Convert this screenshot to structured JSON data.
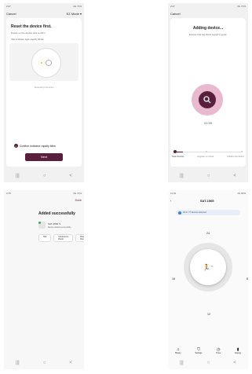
{
  "colors": {
    "accent": "#5a1f3d",
    "pink": "#e9b9cf",
    "gray": "#eaeaea"
  },
  "s1": {
    "status_time": "2:27",
    "status_right": "4G 71%",
    "cancel": "Cancel",
    "mode": "EZ Mode",
    "title": "Reset the device first.",
    "line1": "Power on the device and confirm",
    "line2": "that indicator light rapidly blinks",
    "resetting": "Resetting Devices",
    "confirm": "Confirm indicator rapidly blink",
    "next": "Next"
  },
  "s2": {
    "status_time": "2:27",
    "status_right": "4G 71%",
    "cancel": "Cancel",
    "title": "Adding device...",
    "subtitle": "Ensure that the Wi-Fi signal is good.",
    "timer": "01:59",
    "progress_pct": 12,
    "steps": [
      {
        "label": "Scan devices"
      },
      {
        "label": "Register on Cloud"
      },
      {
        "label": "Initialize the device"
      }
    ]
  },
  "s3": {
    "status_time": "2:15",
    "status_right": "4G 71%",
    "done": "Done",
    "title": "Added successfully",
    "device_name": "SAT-1565",
    "device_sub": "Device added successfully",
    "room_buttons": [
      "Hall",
      "Conference Room",
      "Break Room"
    ]
  },
  "s4": {
    "status_time": "11:01",
    "status_right": "4G 69%",
    "title": "SAT-1565",
    "banner": "Wi-Fi: 77 Devices detected",
    "dial_top": "24",
    "dial_left": "16",
    "dial_right": "8",
    "dial_bottom": "12",
    "tabs": [
      "History",
      "Settings",
      "Timer",
      "Energy"
    ]
  },
  "nav": {
    "recent": "|||",
    "home": "○",
    "back": "<"
  }
}
